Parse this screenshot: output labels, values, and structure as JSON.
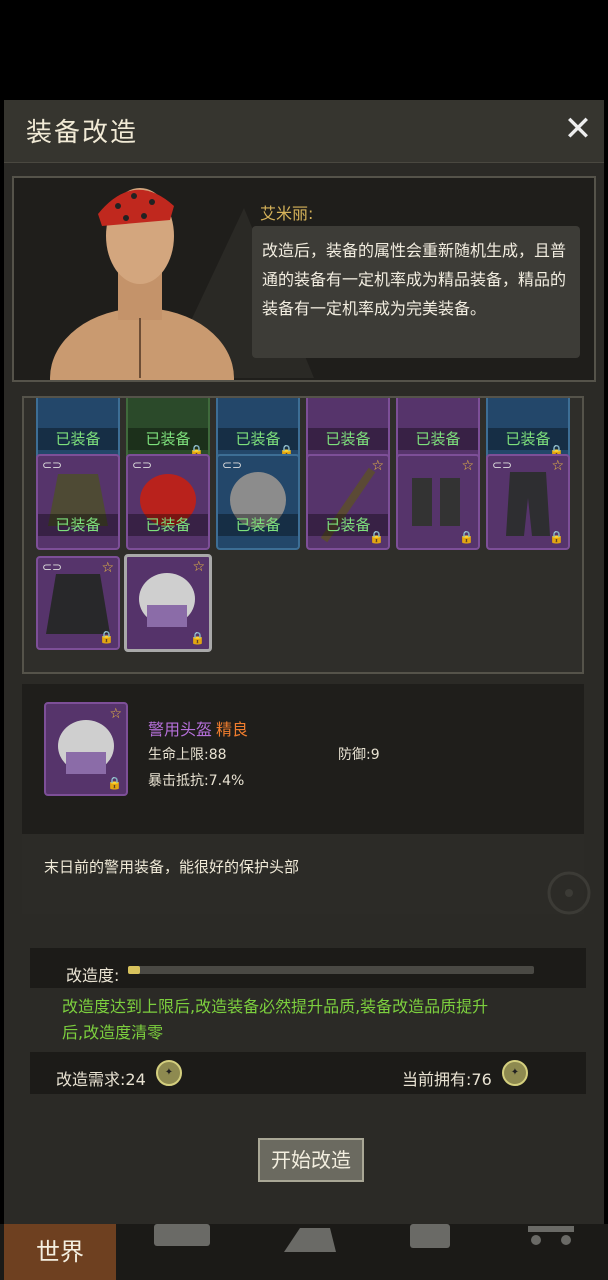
{
  "title": "装备改造",
  "close_icon": "close-icon",
  "npc": {
    "name": "艾米丽:",
    "speech": "改造后，装备的属性会重新随机生成，且普通的装备有一定机率成为精品装备，精品的装备有一定机率成为完美装备。"
  },
  "equipped_label": "已装备",
  "selected_item": {
    "name": "警用头盔",
    "quality": "精良",
    "stats": {
      "hp_label": "生命上限:88",
      "def_label": "防御:9",
      "crit_label": "暴击抵抗:7.4%"
    },
    "description": "末日前的警用装备，能很好的保护头部"
  },
  "modification": {
    "label": "改造度:",
    "progress": 0.03,
    "note": "改造度达到上限后,改造装备必然提升品质,装备改造品质提升后,改造度清零",
    "requirement_label": "改造需求:24",
    "owned_label": "当前拥有:76"
  },
  "start_button": "开始改造",
  "nav": {
    "world": "世界"
  }
}
